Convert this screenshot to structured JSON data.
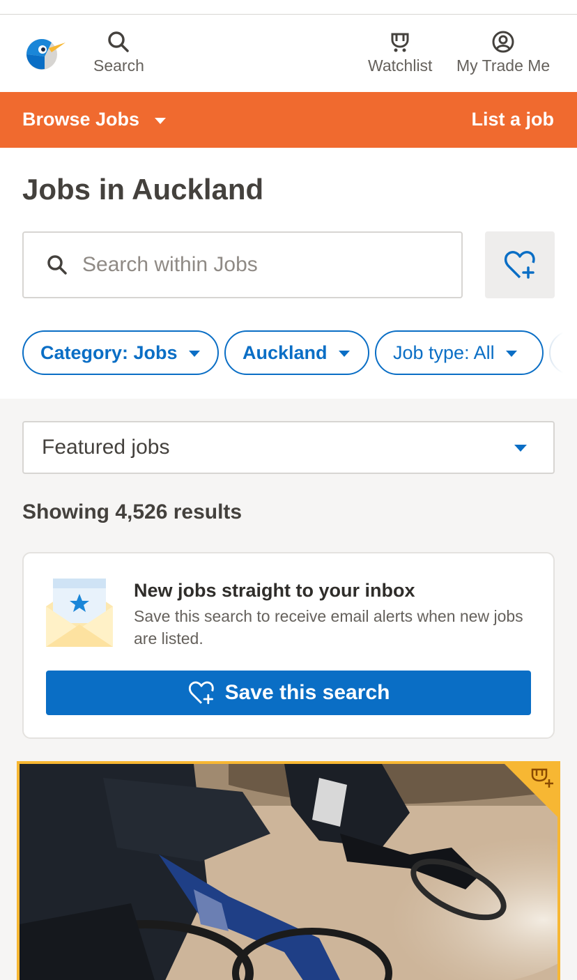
{
  "header": {
    "nav": {
      "search_label": "Search",
      "watchlist_label": "Watchlist",
      "my_trademe_label": "My Trade Me"
    }
  },
  "orange_bar": {
    "browse_label": "Browse Jobs",
    "list_job_label": "List a job"
  },
  "page": {
    "title": "Jobs in Auckland",
    "search_placeholder": "Search within Jobs"
  },
  "filters": {
    "chips": [
      {
        "label": "Category: Jobs"
      },
      {
        "label": "Auckland"
      },
      {
        "label": "Job type: All"
      }
    ]
  },
  "sort": {
    "selected": "Featured jobs"
  },
  "results": {
    "text": "Showing 4,526 results"
  },
  "alert_card": {
    "title": "New jobs straight to your inbox",
    "description": "Save this search to receive email alerts when new jobs are listed.",
    "button_label": "Save this search"
  },
  "colors": {
    "brand_orange": "#f06a2f",
    "action_blue": "#0a6ec5",
    "featured_gold": "#f7b733"
  },
  "icons": [
    "kiwi-logo-icon",
    "search-icon",
    "watchlist-icon",
    "account-icon",
    "chevron-down-icon",
    "heart-plus-icon",
    "envelope-star-icon",
    "watchlist-add-icon"
  ]
}
